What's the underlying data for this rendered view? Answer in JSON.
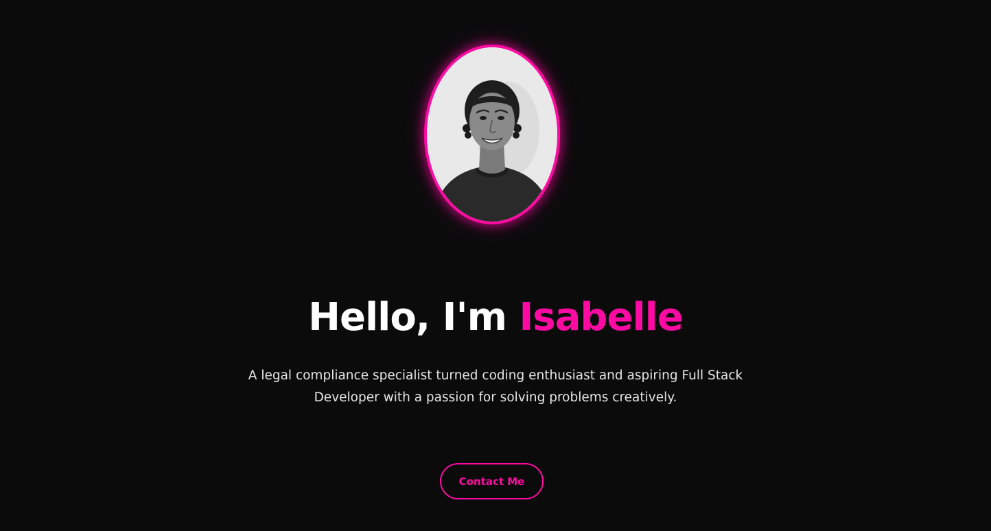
{
  "hero": {
    "portrait_alt": "Portrait of Isabelle",
    "greeting": "Hello, I'm",
    "name": "Isabelle",
    "description": "A legal compliance specialist turned coding enthusiast and aspiring Full Stack Developer with a passion for solving problems creatively.",
    "contact_label": "Contact Me"
  },
  "colors": {
    "background": "#0b0b0c",
    "accent": "#ff0aa3",
    "title": "#ffffff",
    "text": "#e6e6e6"
  }
}
